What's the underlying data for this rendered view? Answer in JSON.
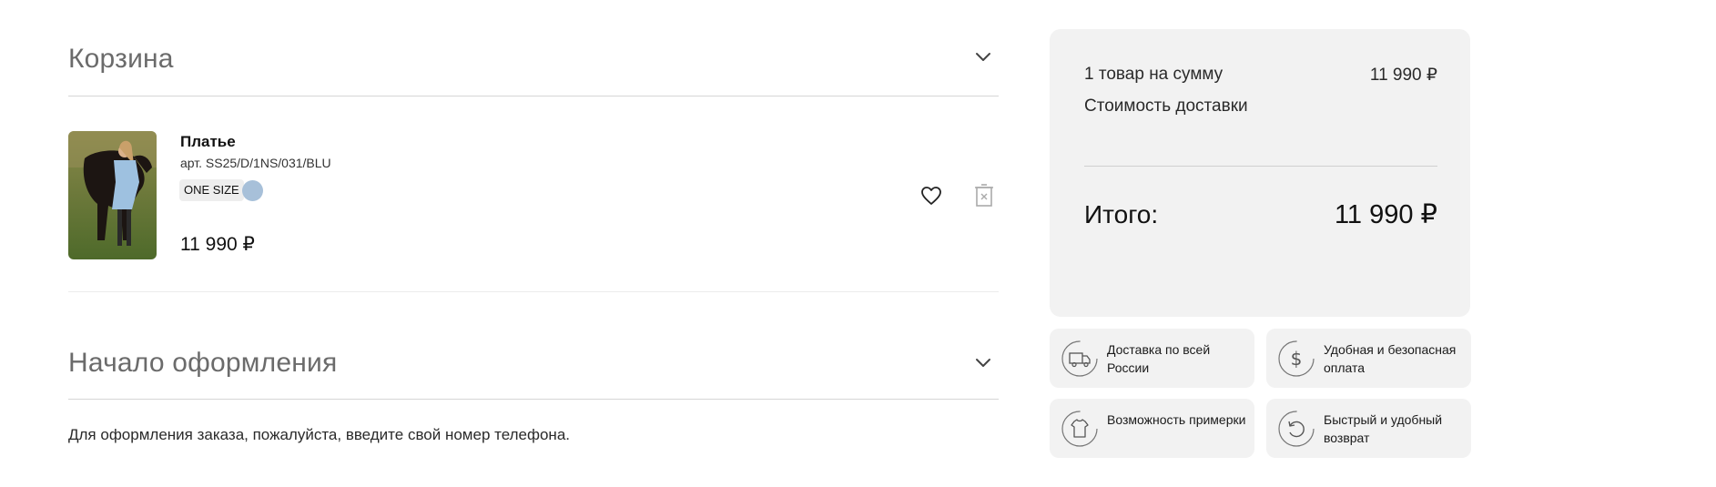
{
  "cart": {
    "title": "Корзина",
    "item": {
      "name": "Платье",
      "sku": "арт. SS25/D/1NS/031/BLU",
      "size": "ONE SIZE",
      "color": "#a7c0d9",
      "price": "11 990 ₽"
    }
  },
  "checkout": {
    "title": "Начало оформления",
    "hint": "Для оформления заказа, пожалуйста, введите свой номер телефона."
  },
  "summary": {
    "items_label": "1 товар на сумму",
    "items_value": "11 990 ₽",
    "delivery_label": "Стоимость доставки",
    "total_label": "Итого:",
    "total_value": "11 990 ₽"
  },
  "features": [
    {
      "icon": "truck-icon",
      "text": "Доставка по всей России"
    },
    {
      "icon": "dollar-icon",
      "text": "Удобная и безопасная оплата"
    },
    {
      "icon": "tshirt-icon",
      "text": "Возможность примерки"
    },
    {
      "icon": "return-icon",
      "text": "Быстрый и удобный возврат"
    }
  ]
}
